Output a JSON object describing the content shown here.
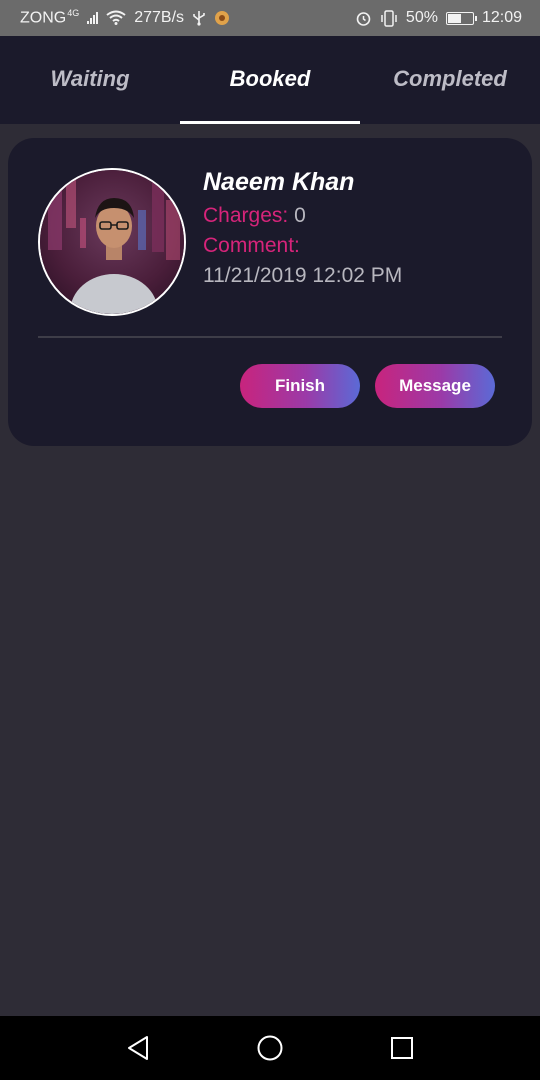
{
  "status_bar": {
    "carrier": "ZONG",
    "network": "4G",
    "speed": "277B/s",
    "battery": "50%",
    "time": "12:09"
  },
  "tabs": [
    {
      "label": "Waiting",
      "active": false
    },
    {
      "label": "Booked",
      "active": true
    },
    {
      "label": "Completed",
      "active": false
    }
  ],
  "booking": {
    "name": "Naeem Khan",
    "charges_label": "Charges:",
    "charges_value": "0",
    "comment_label": "Comment:",
    "comment_value": "",
    "datetime": "11/21/2019 12:02 PM",
    "finish_label": "Finish",
    "message_label": "Message"
  },
  "colors": {
    "accent_pink": "#d6247a",
    "card_bg": "#1b1a2b",
    "page_bg": "#2e2c36"
  },
  "nav": {
    "back_icon": "back-triangle-icon",
    "home_icon": "home-circle-icon",
    "recents_icon": "recents-square-icon"
  }
}
